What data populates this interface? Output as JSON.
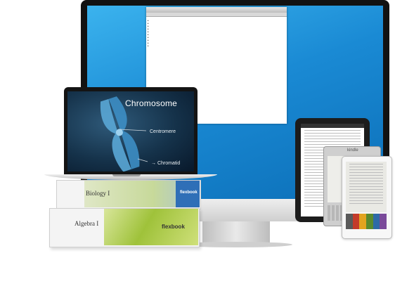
{
  "laptop_screen": {
    "title": "Chromosome",
    "labels": {
      "centromere": "Centromere",
      "chromatid": "Chromatid"
    }
  },
  "books": {
    "top": {
      "title": "Biology I",
      "brand": "flexbook"
    },
    "bottom": {
      "title": "Algebra I",
      "brand": "flexbook"
    }
  },
  "ereader": {
    "brand": "kindle"
  },
  "colors": {
    "desktop_bg": "#1a8ad4",
    "book_green": "#9fc23a",
    "book_blue": "#2f6fb7",
    "bezel": "#121212"
  },
  "nook_palette": [
    "#5a5a5a",
    "#c43b2a",
    "#e2a41f",
    "#5a8a2e",
    "#2e6aa6",
    "#7a4a9a"
  ]
}
